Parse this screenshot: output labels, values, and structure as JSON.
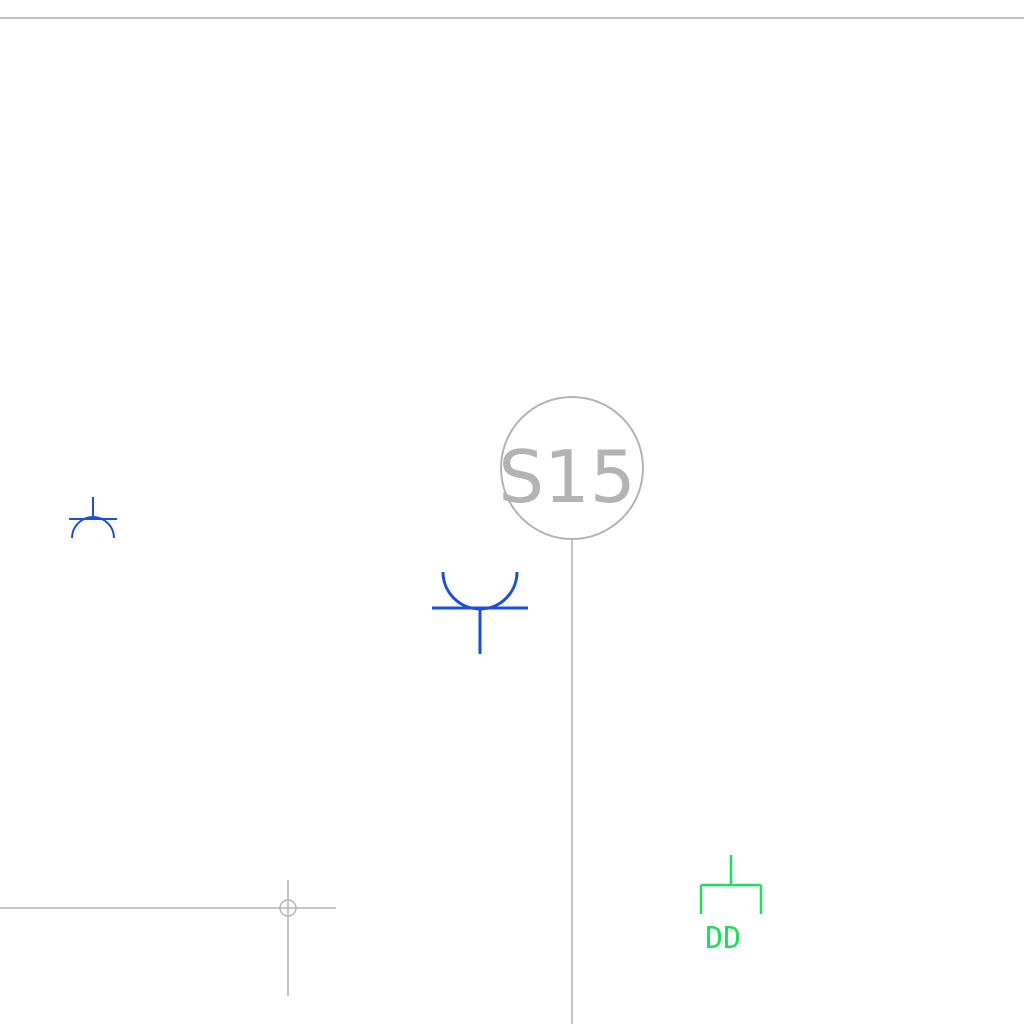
{
  "drawing": {
    "grid_bubble": {
      "label": "S15"
    },
    "equipment_tag": {
      "label": "DD"
    },
    "colors": {
      "grid_line": "#b3b3b3",
      "border_line": "#aaaaaa",
      "symbol_blue": "#1a4fd6",
      "symbol_green": "#1de05a"
    },
    "symbols": [
      {
        "name": "receptacle-small",
        "color": "blue"
      },
      {
        "name": "receptacle-large",
        "color": "blue"
      },
      {
        "name": "equipment-connection",
        "color": "green"
      },
      {
        "name": "reference-crosshair",
        "color": "gray"
      }
    ]
  }
}
